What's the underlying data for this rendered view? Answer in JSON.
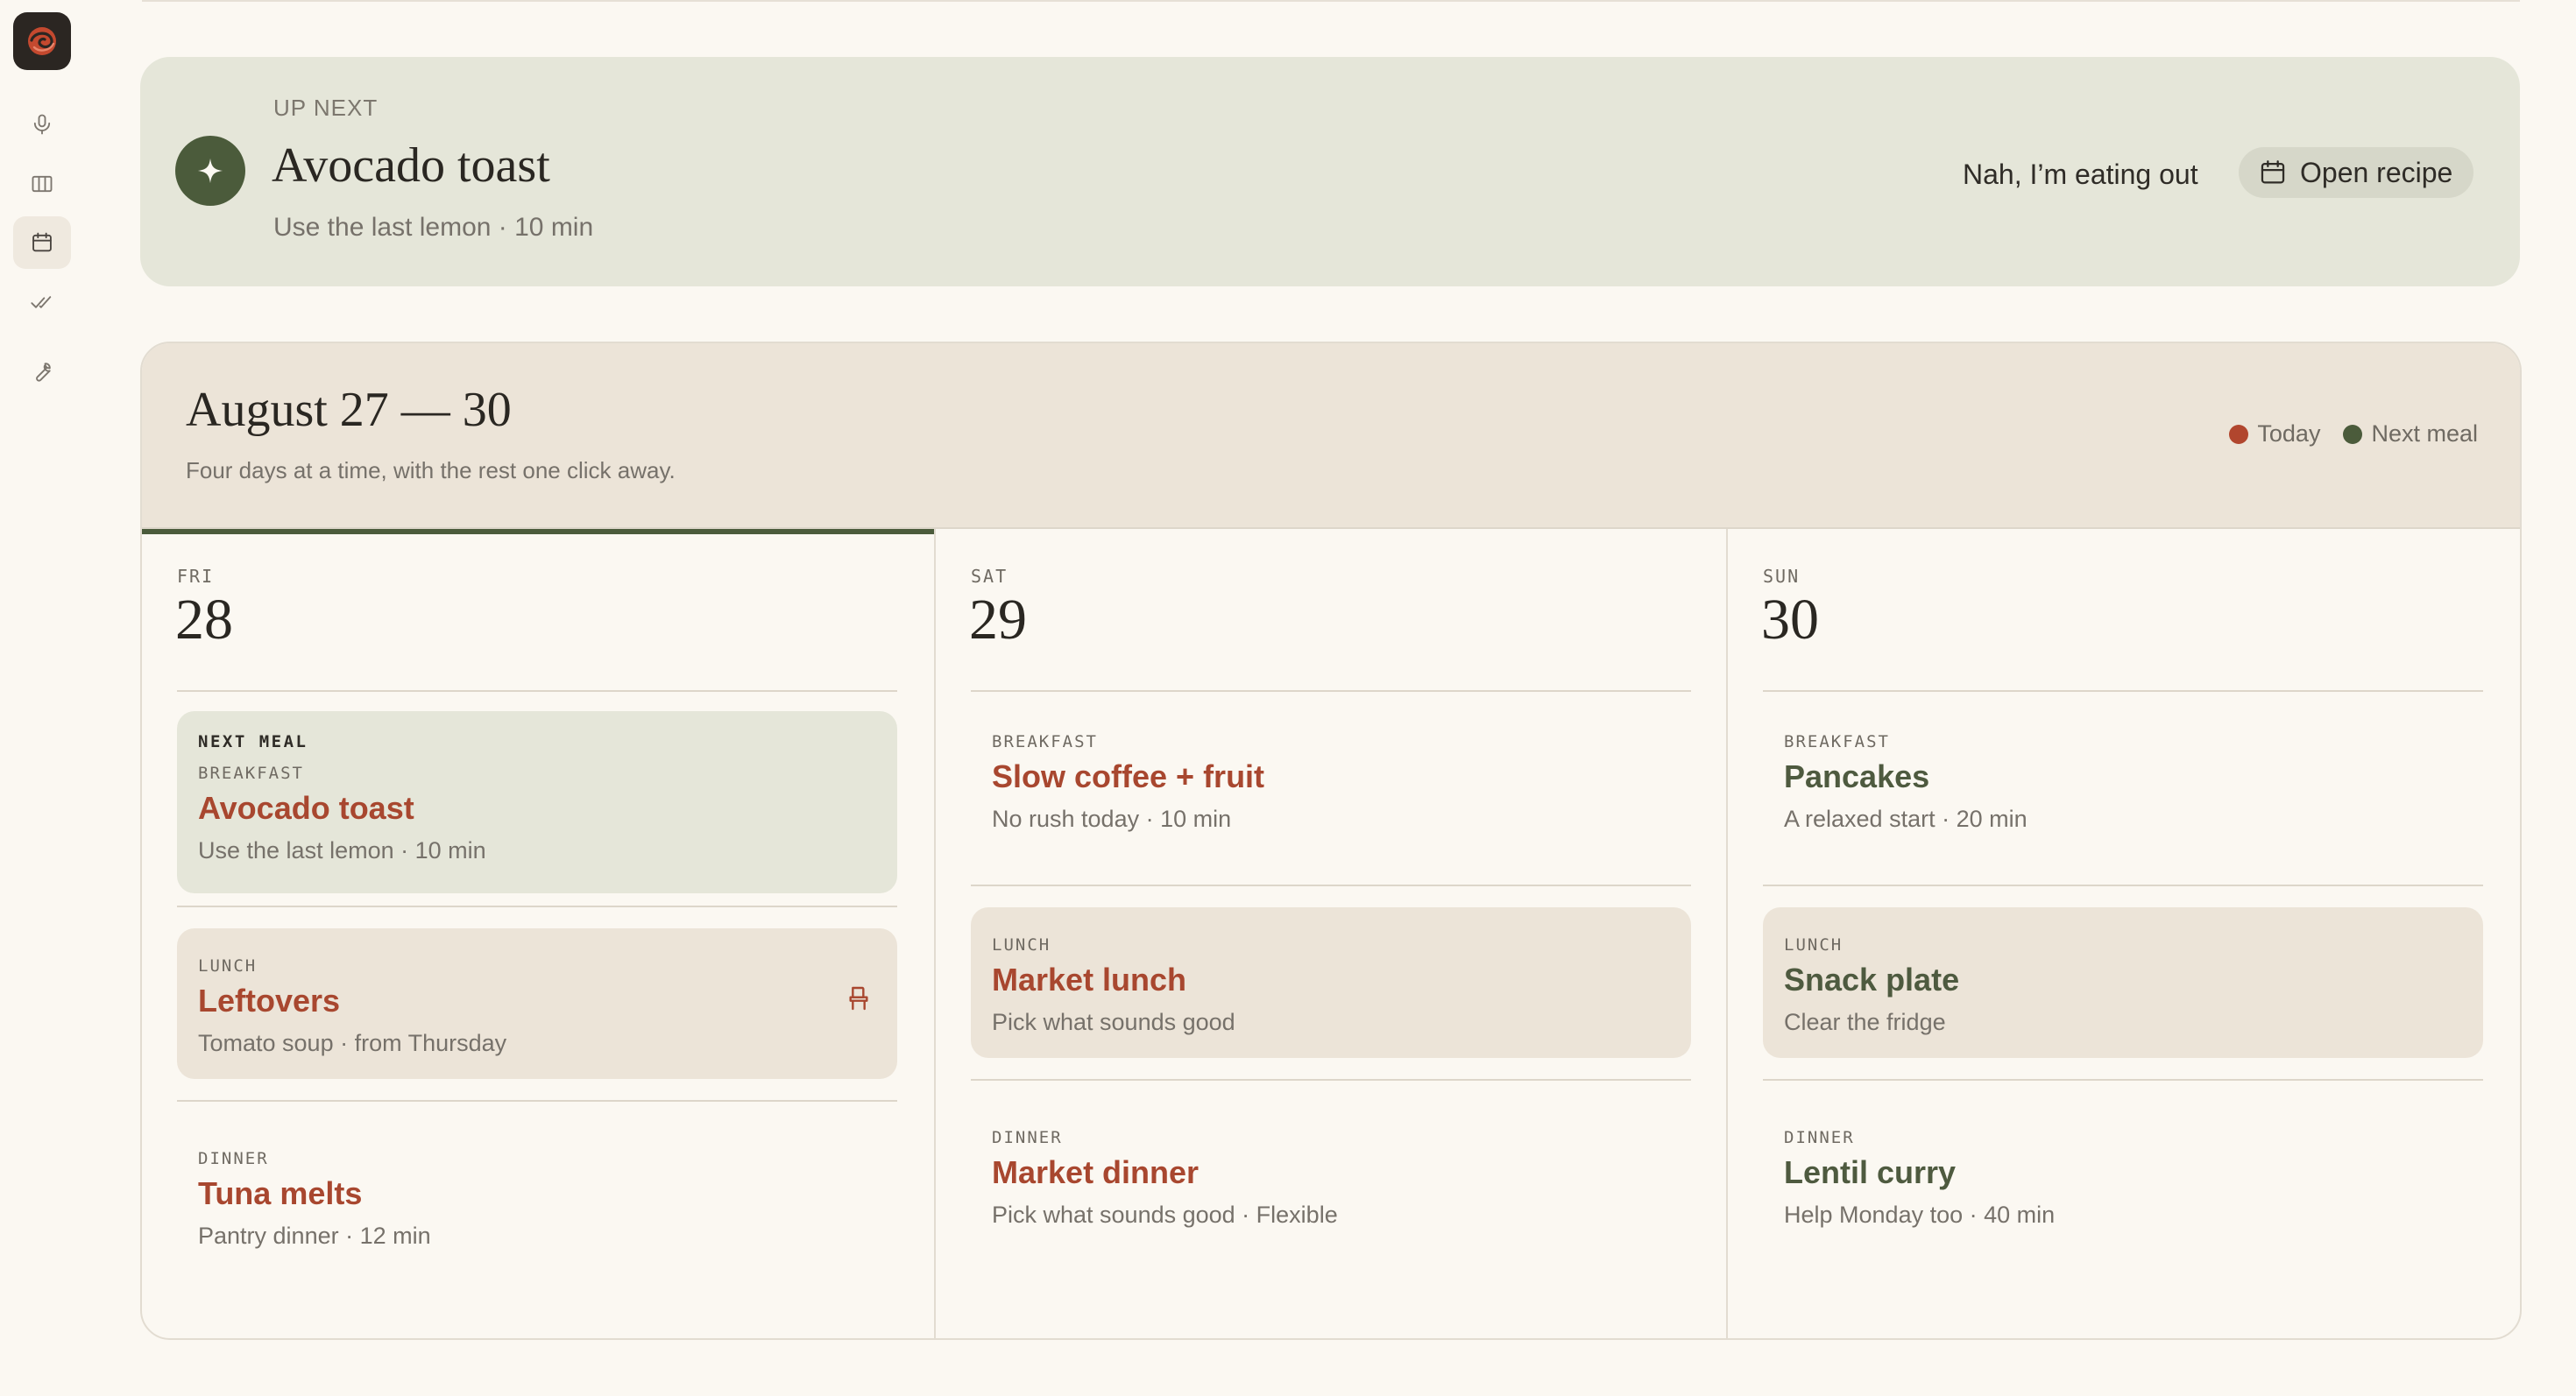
{
  "sidebar": {
    "items": [
      {
        "icon": "microphone-icon"
      },
      {
        "icon": "columns-icon"
      },
      {
        "icon": "calendar-icon",
        "active": true
      },
      {
        "icon": "double-check-icon"
      },
      {
        "icon": "wrench-icon"
      }
    ]
  },
  "up_next": {
    "label": "UP NEXT",
    "title": "Avocado toast",
    "subtitle": "Use the last lemon · 10 min",
    "eat_out_label": "Nah, I’m eating out",
    "open_recipe_label": "Open recipe"
  },
  "calendar": {
    "range": "August 27 — 30",
    "subtitle": "Four days at a time, with the rest one click away.",
    "legend": [
      {
        "label": "Today",
        "color": "#b1462e"
      },
      {
        "label": "Next meal",
        "color": "#4b5b3b"
      }
    ],
    "days": [
      {
        "abbr": "FRI",
        "num": "28",
        "meals": [
          {
            "flag": "NEXT MEAL",
            "tag": "BREAKFAST",
            "name": "Avocado toast",
            "detail": "Use the last lemon · 10 min"
          },
          {
            "tag": "LUNCH",
            "name": "Leftovers",
            "detail": "Tomato soup · from Thursday",
            "icon": "chair-icon"
          },
          {
            "tag": "DINNER",
            "name": "Tuna melts",
            "detail": "Pantry dinner · 12 min"
          }
        ]
      },
      {
        "abbr": "SAT",
        "num": "29",
        "meals": [
          {
            "tag": "BREAKFAST",
            "name": "Slow coffee + fruit",
            "detail": "No rush today · 10 min"
          },
          {
            "tag": "LUNCH",
            "name": "Market lunch",
            "detail": "Pick what sounds good"
          },
          {
            "tag": "DINNER",
            "name": "Market dinner",
            "detail": "Pick what sounds good · Flexible"
          }
        ]
      },
      {
        "abbr": "SUN",
        "num": "30",
        "meals": [
          {
            "tag": "BREAKFAST",
            "name": "Pancakes",
            "detail": "A relaxed start · 20 min"
          },
          {
            "tag": "LUNCH",
            "name": "Snack plate",
            "detail": "Clear the fridge"
          },
          {
            "tag": "DINNER",
            "name": "Lentil curry",
            "detail": "Help Monday too · 40 min"
          }
        ]
      }
    ]
  }
}
